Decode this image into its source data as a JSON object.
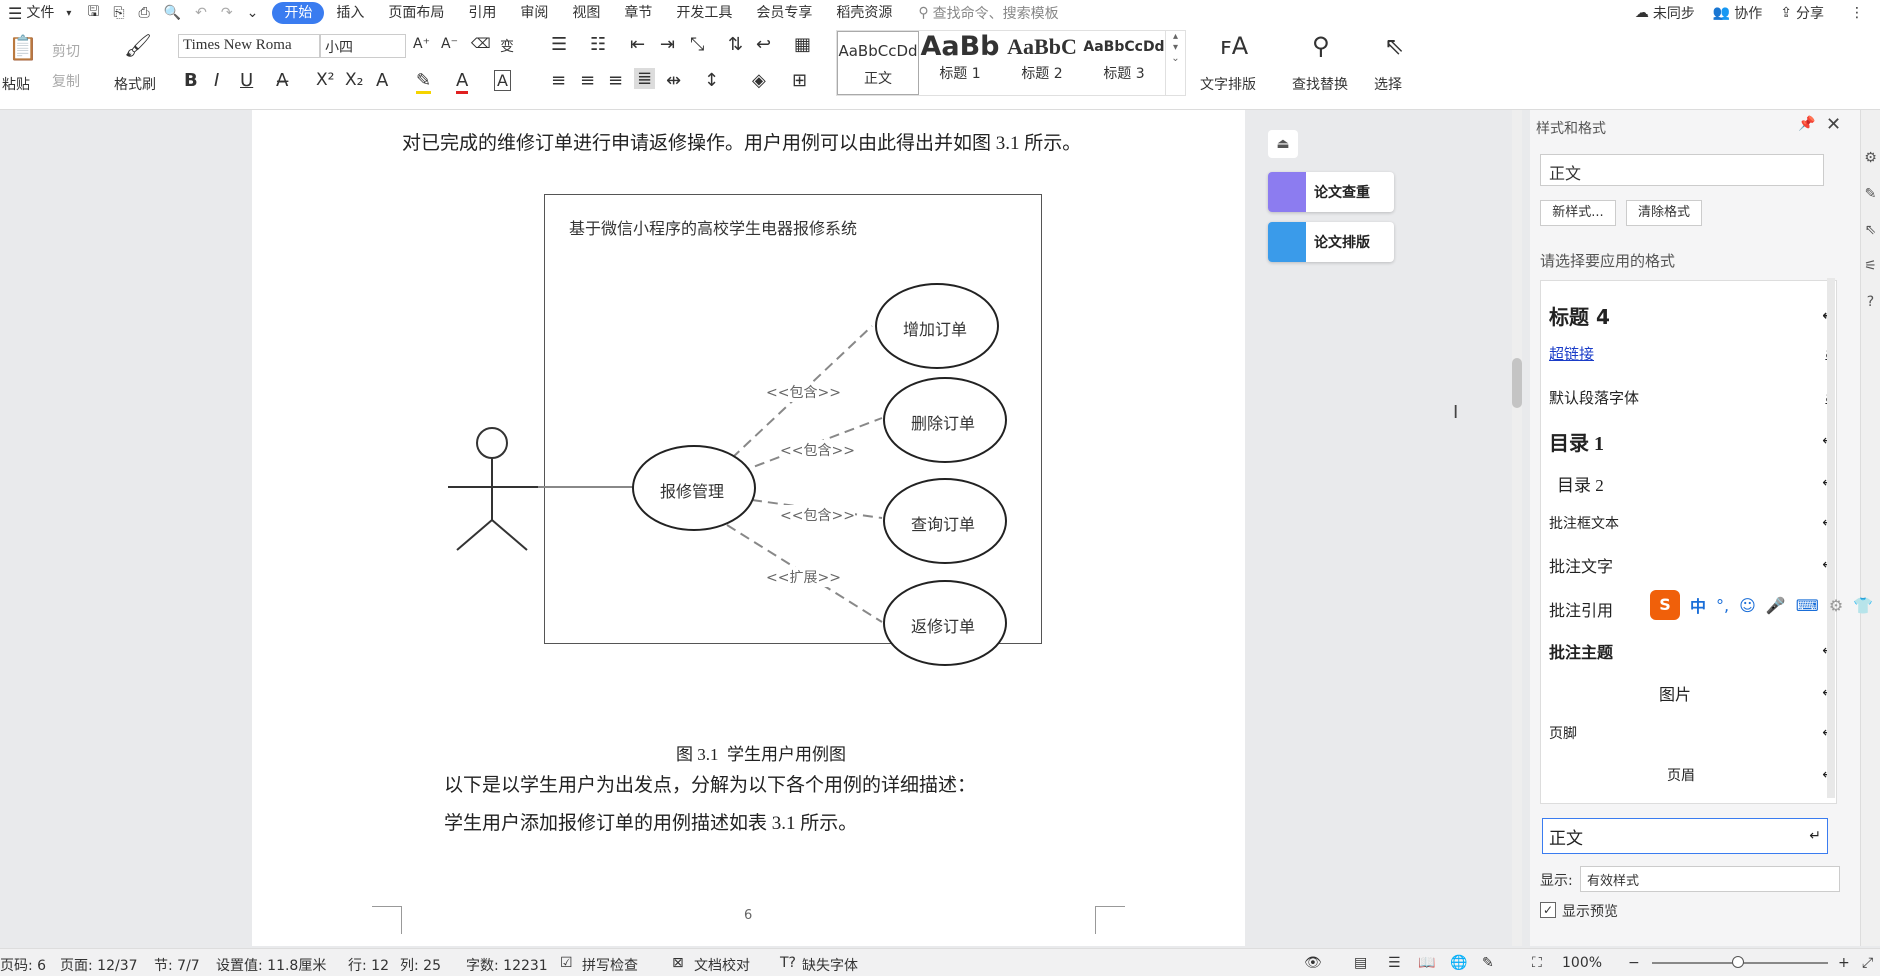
{
  "menu": {
    "file": "文件",
    "tabs": [
      "开始",
      "插入",
      "页面布局",
      "引用",
      "审阅",
      "视图",
      "章节",
      "开发工具",
      "会员专享",
      "稻壳资源"
    ],
    "search_placeholder": "查找命令、搜索模板",
    "unsync": "未同步",
    "collab": "协作",
    "share": "分享"
  },
  "ribbon": {
    "paste": "粘贴",
    "cut": "剪切",
    "copy": "复制",
    "format_painter": "格式刷",
    "font": "Times New Roma",
    "size": "小四",
    "styles": [
      {
        "preview": "AaBbCcDd",
        "name": "正文"
      },
      {
        "preview": "AaBb",
        "name": "标题 1"
      },
      {
        "preview": "AaBbC",
        "name": "标题 2"
      },
      {
        "preview": "AaBbCcDd",
        "name": "标题 3"
      }
    ],
    "text_layout": "文字排版",
    "find_replace": "查找替换",
    "select": "选择"
  },
  "doc": {
    "line1": "对已完成的维修订单进行申请返修操作。用户用例可以由此得出并如图 3.1 所示。",
    "diagram_title": "基于微信小程序的高校学生电器报修系统",
    "center": "报修管理",
    "cases": [
      "增加订单",
      "删除订单",
      "查询订单",
      "返修订单"
    ],
    "rels": [
      "<<包含>>",
      "<<包含>>",
      "<<包含>>",
      "<<扩展>>"
    ],
    "caption": "图 3.1  学生用户用例图",
    "line2": "以下是以学生用户为出发点，分解为以下各个用例的详细描述：",
    "line3": "学生用户添加报修订单的用例描述如表 3.1 所示。",
    "page_num": "6"
  },
  "float": {
    "check": "论文查重",
    "layout": "论文排版"
  },
  "panel": {
    "title": "样式和格式",
    "current": "正文",
    "new_style": "新样式...",
    "clear": "清除格式",
    "prompt": "请选择要应用的格式",
    "items": [
      {
        "label": "标题 4",
        "mark": "↵"
      },
      {
        "label": "超链接",
        "mark": "a"
      },
      {
        "label": "默认段落字体",
        "mark": "a"
      },
      {
        "label": "目录 1",
        "mark": "↵"
      },
      {
        "label": "目录 2",
        "mark": "↵"
      },
      {
        "label": "批注框文本",
        "mark": "↵"
      },
      {
        "label": "批注文字",
        "mark": "↵"
      },
      {
        "label": "批注引用",
        "mark": "a"
      },
      {
        "label": "批注主题",
        "mark": "↵"
      },
      {
        "label": "图片",
        "mark": "↵"
      },
      {
        "label": "页脚",
        "mark": "↵"
      },
      {
        "label": "页眉",
        "mark": "↵"
      },
      {
        "label": "正文",
        "mark": "↵"
      }
    ],
    "show_label": "显示:",
    "show_value": "有效样式",
    "preview": "显示预览"
  },
  "ime": {
    "mode": "中"
  },
  "status": {
    "pagecode": "页码: 6",
    "page": "页面: 12/37",
    "section": "节: 7/7",
    "setting": "设置值: 11.8厘米",
    "row": "行: 12",
    "col": "列: 25",
    "words": "字数: 12231",
    "spell": "拼写检查",
    "proof": "文档校对",
    "missing_font": "缺失字体",
    "zoom": "100%"
  }
}
